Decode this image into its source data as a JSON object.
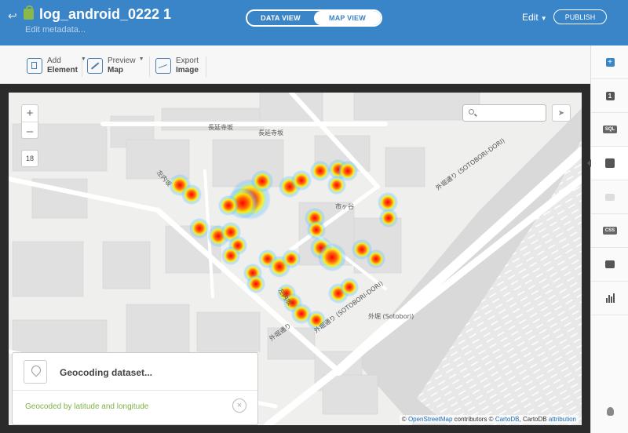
{
  "header": {
    "title": "log_android_0222 1",
    "subtitle": "Edit metadata...",
    "view_toggle": {
      "data_label": "DATA VIEW",
      "map_label": "MAP VIEW",
      "active": "MAP VIEW"
    },
    "edit_label": "Edit",
    "publish_label": "PUBLISH",
    "back_icon": "back-arrow-icon",
    "lock_icon": "lock-icon"
  },
  "toolbar": {
    "add": {
      "line1": "Add",
      "line2": "Element"
    },
    "preview": {
      "line1": "Preview",
      "line2": "Map"
    },
    "export": {
      "line1": "Export",
      "line2": "Image"
    }
  },
  "map": {
    "zoom_in": "+",
    "zoom_out": "–",
    "zoom_level": "18",
    "search_placeholder": "",
    "labels": {
      "chokyuji1": "長延寺坂",
      "chokyuji2": "長延寺坂",
      "sakon": "左内坂",
      "ichigaya": "市ヶ谷",
      "sotobori_dori_right": "外堀通り (SOTOBORI-DORI)",
      "sotobori_dori_left": "外堀通り",
      "sotobori": "外堀 (Sotobori)",
      "sotobori_dori_center": "外堀通り (SOTOBORI-DORI)",
      "sakon2": "左内坂",
      "sotobori_small": "外堀通り"
    },
    "attribution": {
      "prefix": "©",
      "osm": "OpenStreetMap",
      "mid": "contributors ©",
      "carto": "CartoDB",
      "mid2": ", CartoDB",
      "attr": "attribution"
    },
    "heat_colors": [
      "#ff0000",
      "#ffff00",
      "#3366ff"
    ]
  },
  "geocoding": {
    "title": "Geocoding dataset...",
    "status": "Geocoded by latitude and longitude",
    "close": "×"
  },
  "sidebar": {
    "add": "+",
    "layer": "1",
    "sql": "SQL",
    "css": "CSS"
  }
}
